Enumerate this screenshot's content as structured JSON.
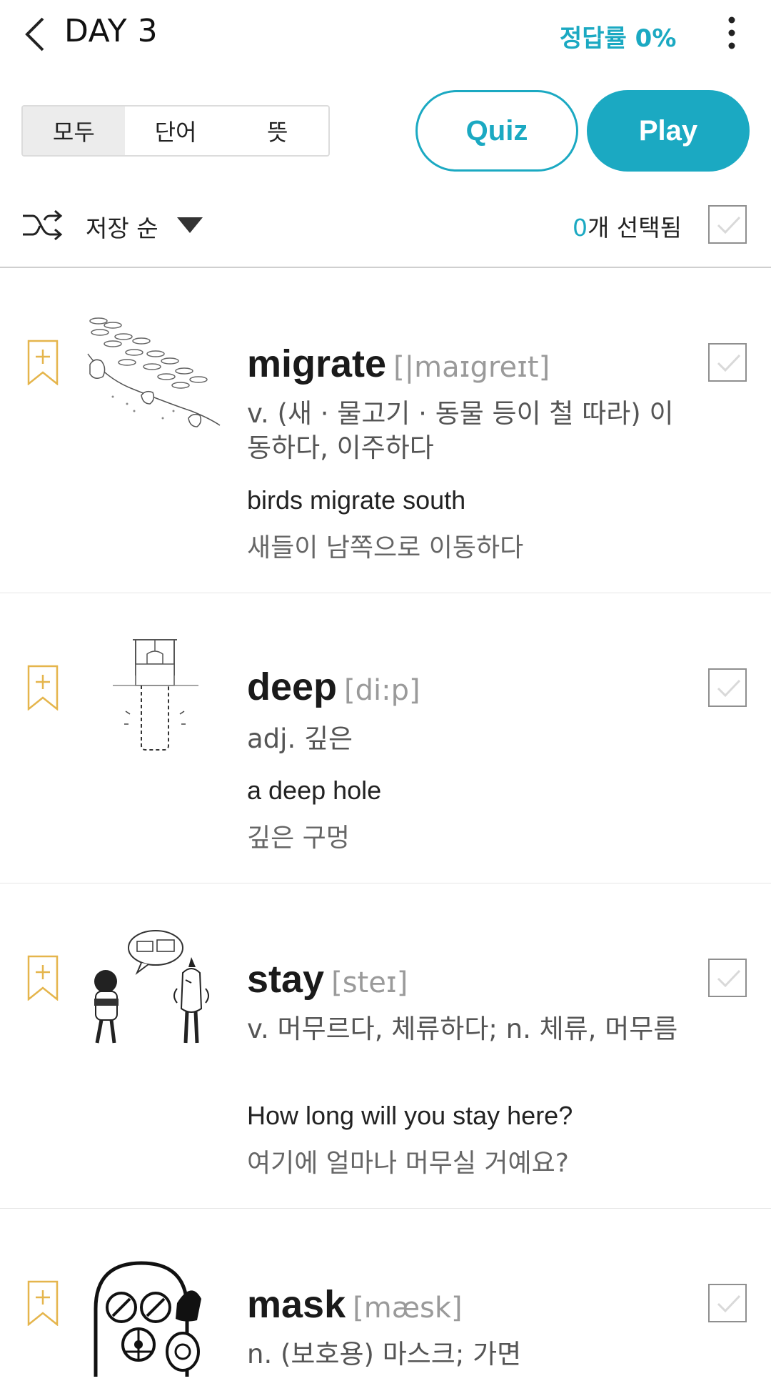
{
  "appbar": {
    "title": "DAY 3",
    "correct_rate": "정답률 0%"
  },
  "segment": {
    "items": [
      "모두",
      "단어",
      "뜻"
    ],
    "selected": "모두"
  },
  "buttons": {
    "quiz": "Quiz",
    "play": "Play"
  },
  "sort": {
    "label": "저장 순"
  },
  "selection": {
    "count": "0",
    "suffix": "개 선택됨"
  },
  "colors": {
    "accent": "#1ba9c2",
    "bookmark": "#e5b54c"
  },
  "words": [
    {
      "word": "migrate",
      "pron": "[|maɪgreɪt]",
      "meaning": "v. (새 · 물고기 · 동물 등이 철 따라) 이동하다, 이주하다",
      "example_en": "birds migrate south",
      "example_ko": "새들이 남쪽으로 이동하다"
    },
    {
      "word": "deep",
      "pron": "[di:p]",
      "meaning": "adj. 깊은",
      "example_en": "a deep hole",
      "example_ko": "깊은 구멍"
    },
    {
      "word": "stay",
      "pron": "[steɪ]",
      "meaning": "v. 머무르다, 체류하다; n. 체류, 머무름",
      "example_en": "How long will you stay here?",
      "example_ko": "여기에 얼마나 머무실 거예요?"
    },
    {
      "word": "mask",
      "pron": "[mæsk]",
      "meaning": "n. (보호용) 마스크; 가면",
      "example_en": "",
      "example_ko": ""
    }
  ],
  "icons": [
    "back-icon",
    "more-icon",
    "shuffle-icon",
    "caret-down-icon",
    "check-icon",
    "bookmark-add-icon"
  ]
}
